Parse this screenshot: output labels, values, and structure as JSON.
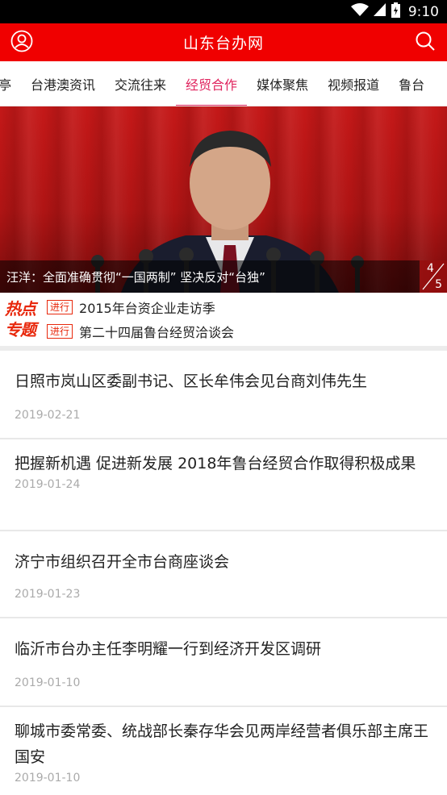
{
  "status_bar": {
    "time": "9:10"
  },
  "header": {
    "title": "山东台办网",
    "left_icon": "user-icon",
    "right_icon": "search-icon"
  },
  "tabs": [
    {
      "label": "亭"
    },
    {
      "label": "台港澳资讯"
    },
    {
      "label": "交流往来"
    },
    {
      "label": "经贸合作",
      "active": true
    },
    {
      "label": "媒体聚焦"
    },
    {
      "label": "视频报道"
    },
    {
      "label": "鲁台"
    }
  ],
  "banner": {
    "caption": "汪洋：全面准确贯彻“一国两制” 坚决反对“台独”",
    "pager_current": "4",
    "pager_total": "5"
  },
  "hot": {
    "logo_line1": "热点",
    "logo_line2": "专题",
    "items": [
      {
        "badge": "进行",
        "text": "2015年台资企业走访季"
      },
      {
        "badge": "进行",
        "text": "第二十四届鲁台经贸洽谈会"
      }
    ]
  },
  "news": [
    {
      "title": "日照市岚山区委副书记、区长牟伟会见台商刘伟先生",
      "date": "2019-02-21"
    },
    {
      "title": "把握新机遇  促进新发展  2018年鲁台经贸合作取得积极成果",
      "date": "2019-01-24"
    },
    {
      "title": "济宁市组织召开全市台商座谈会",
      "date": "2019-01-23"
    },
    {
      "title": "临沂市台办主任李明耀一行到经济开发区调研",
      "date": "2019-01-10"
    },
    {
      "title": "聊城市委常委、统战部长秦存华会见两岸经营者俱乐部主席王国安",
      "date": "2019-01-10"
    }
  ],
  "colors": {
    "brand_red": "#f00000",
    "active_tab": "#e0245e",
    "hot_red": "#e8280c"
  }
}
